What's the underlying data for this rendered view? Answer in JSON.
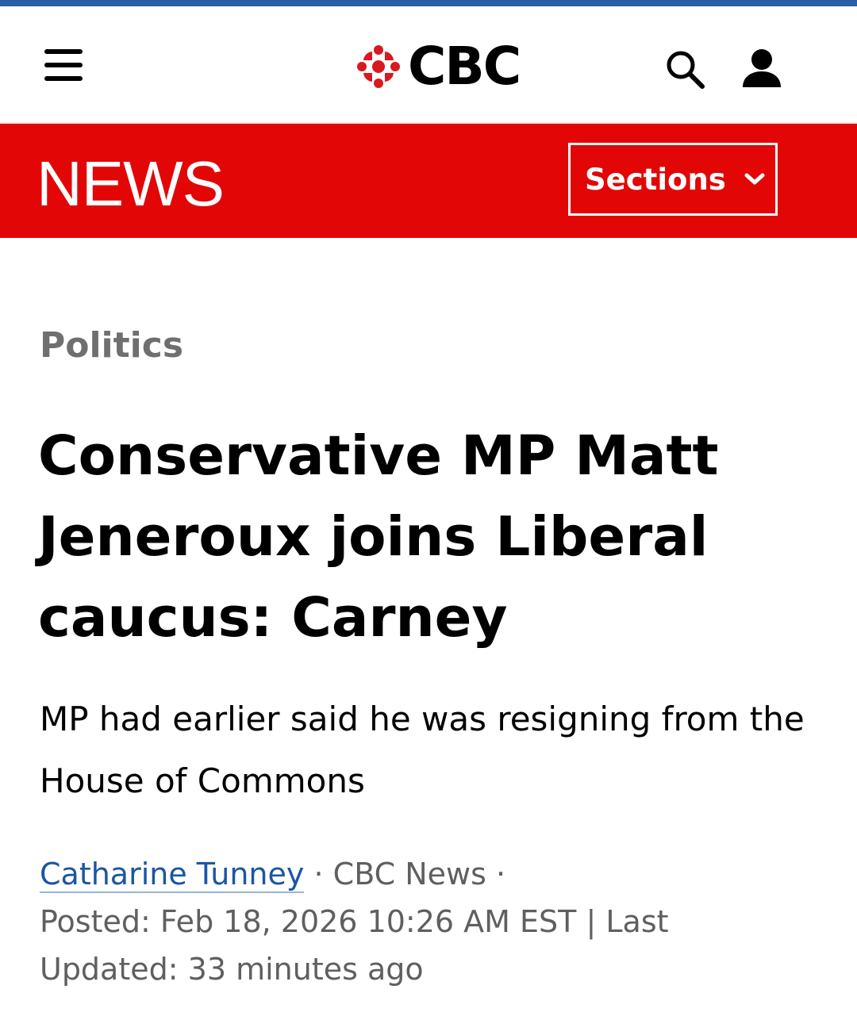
{
  "header": {
    "brand": "CBC",
    "menu_icon": "hamburger-menu-icon",
    "search_icon": "search-icon",
    "account_icon": "user-account-icon",
    "colors": {
      "top_strip": "#2b5ea7",
      "news_bar": "#e30606",
      "logo_red": "#d71920"
    }
  },
  "newsbar": {
    "title": "NEWS",
    "sections_label": "Sections",
    "sections_icon": "chevron-down-icon"
  },
  "article": {
    "category": "Politics",
    "headline": "Conservative MP Matt Jeneroux joins Liberal caucus: Carney",
    "dek": "MP had earlier said he was resigning from the House of Commons",
    "author": "Catharine Tunney",
    "separator": "·",
    "outlet": "CBC News",
    "posted_label": "Posted:",
    "posted_date": "Feb 18, 2026 10:26 AM EST",
    "divider": "|",
    "updated_label": "Last Updated:",
    "updated_value": "33 minutes ago",
    "colors": {
      "category": "#6f6f6f",
      "author_link": "#1b56a3"
    }
  }
}
